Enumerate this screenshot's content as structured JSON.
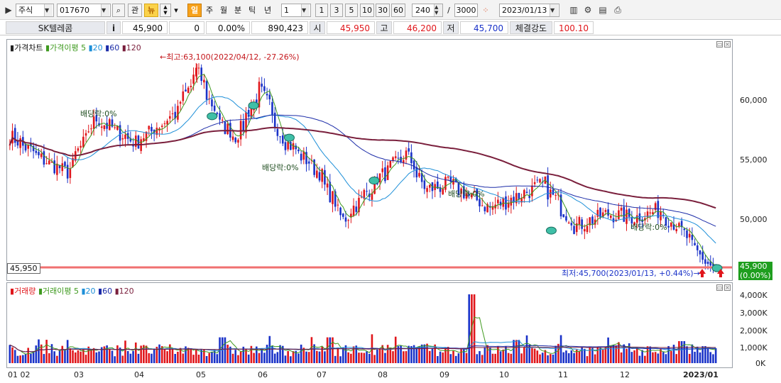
{
  "toolbar": {
    "market": "주식",
    "code": "017670",
    "btn_watch": "관",
    "btn_news": "뉴",
    "periods": [
      "일",
      "주",
      "월",
      "분",
      "틱",
      "년"
    ],
    "interval": "1",
    "quick_intervals": [
      "1",
      "3",
      "5",
      "10",
      "30",
      "60"
    ],
    "count": "240",
    "separator": "/",
    "total": "3000",
    "date": "2023/01/13"
  },
  "quote": {
    "name": "SK텔레콤",
    "info_btn": "i",
    "price": "45,900",
    "change": "0",
    "change_pct": "0.00%",
    "volume": "890,423",
    "open_label": "시",
    "open": "45,950",
    "high_label": "고",
    "high": "46,200",
    "low_label": "저",
    "low": "45,700",
    "strength_label": "체결강도",
    "strength": "100.10"
  },
  "price_pane": {
    "legend": [
      "가격차트",
      "가격이평",
      "5",
      "20",
      "60",
      "120"
    ],
    "axis_labels": [
      "60,000",
      "55,000",
      "50,000"
    ],
    "high_annotation": "←최고:63,100(2022/04/12,  -27.26%)",
    "low_annotation": "최저:45,700(2023/01/13,  +0.44%)→",
    "dividend_labels": [
      "배당락:0%",
      "배당락:0%",
      "배당락:0%",
      "배당락:0%"
    ],
    "cursor_price": "45,950",
    "current_price": "45,900",
    "current_change": "(0.00%)"
  },
  "volume_pane": {
    "legend": [
      "거래량",
      "거래이평",
      "5",
      "20",
      "60",
      "120"
    ],
    "axis_labels": [
      "4,000K",
      "3,000K",
      "2,000K",
      "1,000K",
      "0K"
    ]
  },
  "x_axis": [
    "01 02",
    "03",
    "04",
    "05",
    "06",
    "07",
    "08",
    "09",
    "10",
    "11",
    "12",
    "2023/01"
  ],
  "colors": {
    "up": "#e0161b",
    "down": "#1a32c8",
    "ma5": "#3f9a1f",
    "ma20": "#1d8fd8",
    "ma60": "#1c2ca8",
    "ma120": "#7a1f3c",
    "hline": "#f07070",
    "accent": "#f7a21b"
  },
  "chart_data": {
    "type": "candlestick",
    "title": "",
    "x_range": [
      "2022/01/02",
      "2023/01/13"
    ],
    "y_range": [
      45700,
      63100
    ],
    "high": {
      "value": 63100,
      "date": "2022/04/12",
      "pct": -27.26
    },
    "low": {
      "value": 45700,
      "date": "2023/01/13",
      "pct": 0.44
    },
    "anchors": [
      [
        "2022/01/03",
        57000
      ],
      [
        "2022/01/20",
        55000
      ],
      [
        "2022/02/02",
        54000
      ],
      [
        "2022/02/17",
        58500
      ],
      [
        "2022/03/10",
        56500
      ],
      [
        "2022/04/01",
        59000
      ],
      [
        "2022/04/12",
        62500
      ],
      [
        "2022/04/25",
        58000
      ],
      [
        "2022/05/03",
        57000
      ],
      [
        "2022/05/16",
        61000
      ],
      [
        "2022/05/27",
        57000
      ],
      [
        "2022/06/16",
        54000
      ],
      [
        "2022/06/29",
        50000
      ],
      [
        "2022/07/18",
        53500
      ],
      [
        "2022/08/02",
        55500
      ],
      [
        "2022/08/12",
        52500
      ],
      [
        "2022/08/25",
        53000
      ],
      [
        "2022/09/15",
        51000
      ],
      [
        "2022/09/30",
        52000
      ],
      [
        "2022/10/14",
        53000
      ],
      [
        "2022/10/31",
        49500
      ],
      [
        "2022/11/17",
        50500
      ],
      [
        "2022/12/01",
        50200
      ],
      [
        "2022/12/15",
        50800
      ],
      [
        "2022/12/27",
        49000
      ],
      [
        "2023/01/05",
        47000
      ],
      [
        "2023/01/13",
        45900
      ]
    ],
    "volume_range": [
      0,
      4000000
    ],
    "volume_spikes": [
      [
        "2022/09/06",
        4000000
      ],
      [
        "2022/04/26",
        1500000
      ],
      [
        "2022/06/22",
        1500000
      ],
      [
        "2022/09/29",
        1350000
      ],
      [
        "2022/12/27",
        1280000
      ]
    ]
  }
}
